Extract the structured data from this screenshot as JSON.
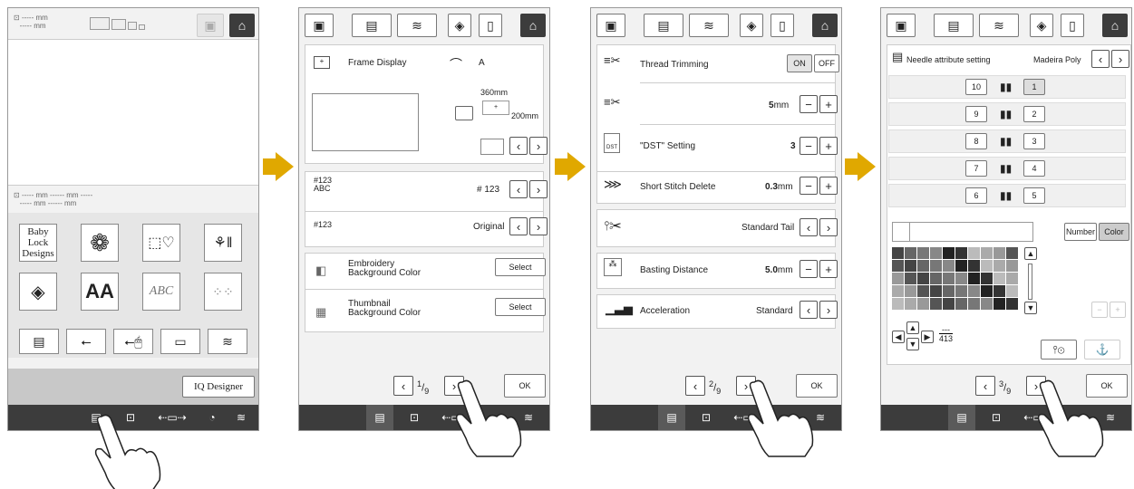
{
  "screen1": {
    "size_placeholder_top": "----- mm",
    "size_placeholder_top2": "----- mm",
    "size_row1": "----- mm   ------ mm   -----",
    "size_row2": "----- mm   ------ mm",
    "patterns": [
      "Baby Lock Designs",
      "",
      "",
      "",
      "",
      "AA",
      "ABC",
      "",
      ""
    ],
    "iq_designer": "IQ Designer"
  },
  "screen2": {
    "frame_display_label": "Frame Display",
    "frame_value": "A",
    "frame_width": "360mm",
    "frame_height": "200mm",
    "thread_num_icon": "#123 ABC",
    "thread_num_value": "# 123",
    "thread_brand_icon": "#123",
    "thread_brand_value": "Original",
    "emb_bg_label": "Embroidery Background Color",
    "emb_bg_btn": "Select",
    "thumb_bg_label": "Thumbnail Background Color",
    "thumb_bg_btn": "Select",
    "page_num": "1",
    "page_den": "9",
    "ok": "OK"
  },
  "screen3": {
    "thread_trimming": "Thread Trimming",
    "on": "ON",
    "off": "OFF",
    "trim_value": "5",
    "trim_unit": "mm",
    "dst_label": "\"DST\" Setting",
    "dst_value": "3",
    "dst_icon": "DST",
    "short_stitch": "Short Stitch Delete",
    "short_value": "0.3",
    "short_unit": "mm",
    "tail_value": "Standard Tail",
    "basting": "Basting Distance",
    "basting_value": "5.0",
    "basting_unit": "mm",
    "accel": "Acceleration",
    "accel_value": "Standard",
    "page_num": "2",
    "page_den": "9",
    "ok": "OK"
  },
  "screen4": {
    "needle_attr": "Needle attribute setting",
    "brand": "Madeira Poly",
    "left_needles": [
      "10",
      "9",
      "8",
      "7",
      "6"
    ],
    "right_needles": [
      "1",
      "2",
      "3",
      "4",
      "5"
    ],
    "number_btn": "Number",
    "color_btn": "Color",
    "code_top": "---",
    "code_bottom": "413",
    "page_num": "3",
    "page_den": "9",
    "ok": "OK"
  },
  "icons": {
    "home": "home-icon",
    "wifi": "wifi-icon",
    "ok": "OK"
  }
}
